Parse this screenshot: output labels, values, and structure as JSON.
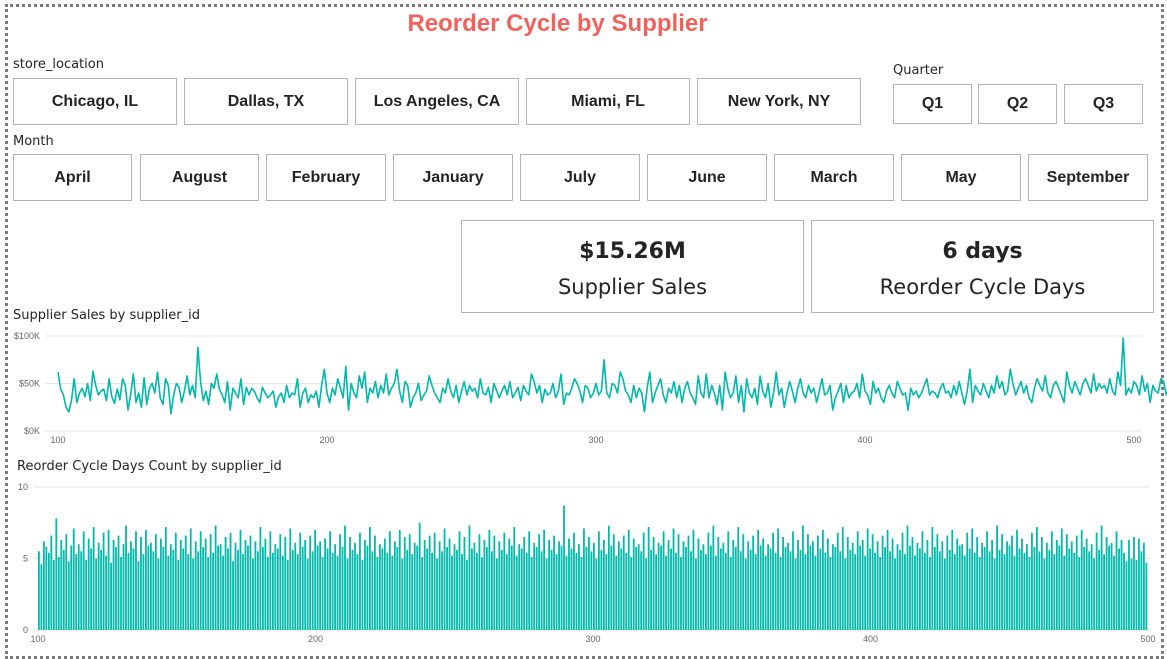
{
  "title": "Reorder Cycle by Supplier",
  "store_slicer": {
    "label": "store_location",
    "options": [
      "Chicago, IL",
      "Dallas, TX",
      "Los Angeles, CA",
      "Miami, FL",
      "New York, NY"
    ]
  },
  "quarter_slicer": {
    "label": "Quarter",
    "options": [
      "Q1",
      "Q2",
      "Q3"
    ]
  },
  "month_slicer": {
    "label": "Month",
    "options": [
      "April",
      "August",
      "February",
      "January",
      "July",
      "June",
      "March",
      "May",
      "September"
    ]
  },
  "cards": [
    {
      "value": "$15.26M",
      "label": "Supplier Sales"
    },
    {
      "value": "6 days",
      "label": "Reorder Cycle Days"
    }
  ],
  "colors": {
    "accent": "#01b8aa",
    "title": "#f0625b"
  },
  "chart_data": [
    {
      "type": "line",
      "title": "Supplier Sales by supplier_id",
      "xlim": [
        100,
        500
      ],
      "ylim": [
        0,
        100000
      ],
      "x_ticks": [
        "100",
        "200",
        "300",
        "400",
        "500"
      ],
      "y_ticks": [
        "$0K",
        "$50K",
        "$100K"
      ],
      "x_start": 100,
      "grid": true,
      "values": [
        62000,
        44000,
        38000,
        25000,
        20000,
        32000,
        55000,
        30000,
        40000,
        45000,
        36000,
        50000,
        32000,
        63000,
        48000,
        38000,
        42000,
        44000,
        32000,
        55000,
        36000,
        29000,
        44000,
        33000,
        55000,
        48000,
        22000,
        38000,
        60000,
        30000,
        40000,
        25000,
        56000,
        28000,
        45000,
        50000,
        40000,
        62000,
        35000,
        28000,
        55000,
        48000,
        18000,
        38000,
        50000,
        46000,
        30000,
        42000,
        58000,
        38000,
        48000,
        35000,
        88000,
        52000,
        32000,
        42000,
        28000,
        50000,
        45000,
        60000,
        44000,
        38000,
        30000,
        52000,
        22000,
        45000,
        40000,
        35000,
        55000,
        28000,
        46000,
        38000,
        45000,
        42000,
        35000,
        30000,
        46000,
        40000,
        35000,
        38000,
        42000,
        25000,
        36000,
        40000,
        30000,
        48000,
        35000,
        40000,
        38000,
        55000,
        25000,
        40000,
        45000,
        30000,
        38000,
        35000,
        42000,
        25000,
        48000,
        65000,
        40000,
        30000,
        45000,
        38000,
        55000,
        45000,
        35000,
        68000,
        22000,
        50000,
        40000,
        35000,
        58000,
        45000,
        62000,
        30000,
        45000,
        40000,
        52000,
        35000,
        48000,
        40000,
        60000,
        38000,
        45000,
        50000,
        65000,
        42000,
        30000,
        52000,
        48000,
        25000,
        35000,
        40000,
        50000,
        32000,
        38000,
        42000,
        58000,
        48000,
        40000,
        35000,
        30000,
        45000,
        40000,
        55000,
        42000,
        35000,
        48000,
        30000,
        42000,
        52000,
        38000,
        48000,
        42000,
        45000,
        35000,
        55000,
        40000,
        38000,
        46000,
        30000,
        50000,
        43000,
        35000,
        42000,
        48000,
        38000,
        52000,
        35000,
        40000,
        46000,
        32000,
        48000,
        42000,
        38000,
        60000,
        52000,
        40000,
        48000,
        30000,
        44000,
        38000,
        40000,
        50000,
        35000,
        42000,
        60000,
        28000,
        40000,
        38000,
        45000,
        55000,
        50000,
        42000,
        30000,
        48000,
        45000,
        35000,
        40000,
        50000,
        38000,
        42000,
        75000,
        40000,
        35000,
        50000,
        48000,
        40000,
        62000,
        55000,
        42000,
        38000,
        30000,
        48000,
        35000,
        45000,
        40000,
        20000,
        45000,
        62000,
        30000,
        40000,
        48000,
        55000,
        38000,
        30000,
        45000,
        40000,
        52000,
        35000,
        48000,
        30000,
        45000,
        52000,
        40000,
        35000,
        28000,
        58000,
        40000,
        35000,
        60000,
        35000,
        48000,
        40000,
        28000,
        48000,
        22000,
        62000,
        45000,
        35000,
        40000,
        58000,
        30000,
        48000,
        20000,
        55000,
        40000,
        35000,
        45000,
        28000,
        58000,
        42000,
        35000,
        50000,
        25000,
        40000,
        62000,
        38000,
        45000,
        25000,
        40000,
        52000,
        42000,
        30000,
        45000,
        55000,
        40000,
        35000,
        48000,
        40000,
        45000,
        30000,
        42000,
        55000,
        38000,
        40000,
        48000,
        22000,
        35000,
        42000,
        50000,
        30000,
        48000,
        35000,
        40000,
        42000,
        50000,
        35000,
        60000,
        42000,
        38000,
        28000,
        52000,
        40000,
        45000,
        35000,
        30000,
        42000,
        48000,
        40000,
        35000,
        52000,
        45000,
        38000,
        40000,
        22000,
        45000,
        38000,
        42000,
        35000,
        40000,
        48000,
        55000,
        38000,
        42000,
        40000,
        35000,
        45000,
        50000,
        40000,
        42000,
        35000,
        48000,
        38000,
        52000,
        40000,
        28000,
        42000,
        65000,
        30000,
        48000,
        42000,
        38000,
        50000,
        42000,
        35000,
        48000,
        40000,
        58000,
        45000,
        52000,
        38000,
        42000,
        65000,
        50000,
        38000,
        45000,
        52000,
        40000,
        48000,
        35000,
        30000,
        45000,
        55000,
        48000,
        42000,
        58000,
        40000,
        35000,
        48000,
        52000,
        45000,
        38000,
        30000,
        62000,
        48000,
        40000,
        52000,
        45000,
        38000,
        50000,
        55000,
        48000,
        40000,
        60000,
        42000,
        50000,
        45000,
        48000,
        40000,
        55000,
        42000,
        38000,
        62000,
        48000,
        98000,
        38000,
        45000,
        40000,
        52000,
        48000,
        38000,
        58000,
        42000,
        50000,
        30000,
        48000,
        42000,
        40000,
        55000,
        52000,
        38000,
        45000,
        40000,
        48000,
        68000,
        42000,
        55000,
        45000,
        40000,
        72000,
        38000,
        55000,
        48000,
        45000,
        38000,
        60000,
        42000,
        35000,
        50000,
        45000,
        42000,
        55000,
        40000,
        48000,
        52000,
        30000,
        55000,
        50000,
        50000
      ]
    },
    {
      "type": "bar",
      "title": "Reorder Cycle Days Count by supplier_id",
      "xlim": [
        100,
        500
      ],
      "ylim": [
        0,
        10
      ],
      "x_ticks": [
        "100",
        "200",
        "300",
        "400",
        "500"
      ],
      "y_ticks": [
        "0",
        "5",
        "10"
      ],
      "x_start": 100,
      "grid": true,
      "values": [
        5.5,
        4.6,
        6.2,
        5.8,
        5.4,
        6.6,
        4.9,
        7.8,
        5.1,
        6.3,
        5.6,
        6.7,
        4.8,
        5.9,
        7.1,
        5.3,
        6.0,
        5.5,
        6.9,
        4.9,
        6.4,
        5.7,
        7.2,
        5.0,
        6.1,
        5.6,
        6.8,
        5.2,
        7.0,
        4.7,
        6.3,
        5.8,
        6.6,
        5.1,
        6.0,
        7.3,
        5.4,
        6.2,
        5.7,
        6.9,
        4.8,
        6.5,
        5.3,
        7.0,
        5.9,
        6.1,
        5.5,
        6.7,
        5.0,
        6.4,
        5.8,
        7.2,
        5.2,
        6.0,
        5.6,
        6.8,
        4.9,
        6.3,
        5.7,
        6.6,
        5.3,
        7.1,
        5.0,
        6.2,
        5.5,
        6.9,
        5.8,
        6.4,
        5.1,
        6.7,
        5.4,
        7.3,
        5.9,
        6.0,
        5.2,
        6.5,
        5.7,
        6.8,
        4.8,
        6.1,
        5.6,
        7.0,
        5.3,
        6.3,
        5.9,
        6.6,
        5.0,
        6.2,
        5.5,
        7.2,
        5.8,
        6.4,
        5.1,
        6.9,
        5.4,
        6.0,
        5.7,
        6.7,
        5.2,
        6.5,
        4.9,
        7.1,
        5.6,
        6.1,
        5.3,
        6.8,
        5.8,
        6.3,
        5.0,
        6.6,
        5.5,
        7.0,
        5.9,
        6.2,
        5.1,
        6.4,
        5.7,
        6.9,
        5.4,
        6.0,
        5.2,
        6.7,
        5.8,
        7.3,
        5.0,
        6.5,
        5.6,
        6.1,
        5.3,
        6.8,
        4.9,
        6.3,
        5.9,
        7.2,
        5.5,
        6.6,
        5.1,
        6.0,
        5.7,
        6.4,
        5.4,
        6.9,
        5.2,
        6.2,
        5.8,
        7.0,
        5.0,
        6.5,
        5.6,
        6.7,
        5.3,
        6.1,
        5.9,
        7.5,
        5.1,
        6.3,
        5.7,
        6.6,
        5.4,
        6.8,
        5.0,
        6.2,
        5.5,
        7.1,
        5.8,
        6.4,
        5.2,
        6.0,
        5.6,
        6.9,
        5.3,
        6.5,
        4.9,
        7.3,
        5.7,
        6.1,
        5.4,
        6.7,
        5.1,
        6.3,
        5.8,
        7.0,
        5.5,
        6.6,
        5.0,
        6.2,
        5.6,
        6.8,
        5.3,
        6.4,
        5.9,
        7.2,
        5.2,
        6.0,
        5.7,
        6.5,
        5.4,
        6.9,
        5.1,
        6.1,
        5.8,
        6.7,
        5.5,
        7.0,
        5.0,
        6.3,
        5.6,
        6.6,
        5.3,
        6.2,
        5.9,
        8.7,
        5.2,
        6.4,
        5.7,
        6.8,
        5.4,
        6.0,
        5.1,
        7.1,
        5.8,
        6.5,
        5.5,
        6.1,
        5.0,
        6.9,
        5.6,
        6.3,
        5.3,
        7.3,
        5.9,
        6.7,
        5.2,
        6.2,
        5.7,
        6.6,
        5.4,
        7.0,
        5.1,
        6.4,
        5.8,
        6.0,
        5.5,
        6.8,
        5.0,
        7.2,
        5.6,
        6.5,
        5.3,
        6.1,
        5.9,
        6.9,
        5.2,
        6.3,
        5.7,
        7.1,
        5.4,
        6.7,
        5.1,
        6.2,
        5.8,
        6.6,
        5.5,
        7.0,
        5.0,
        6.4,
        5.6,
        6.0,
        5.3,
        6.8,
        5.9,
        7.3,
        5.2,
        6.5,
        5.7,
        6.1,
        5.4,
        6.9,
        5.1,
        6.3,
        5.8,
        7.2,
        5.5,
        6.7,
        5.0,
        6.2,
        5.6,
        6.6,
        5.3,
        7.0,
        5.9,
        6.4,
        5.2,
        6.0,
        5.7,
        6.8,
        5.4,
        7.1,
        5.1,
        6.5,
        5.8,
        6.1,
        5.5,
        6.9,
        5.0,
        6.3,
        5.6,
        7.3,
        5.3,
        6.7,
        5.9,
        6.2,
        5.2,
        6.6,
        5.7,
        7.0,
        5.4,
        6.4,
        5.1,
        6.0,
        5.8,
        6.8,
        5.5,
        7.2,
        5.0,
        6.5,
        5.6,
        6.1,
        5.3,
        6.9,
        5.9,
        6.3,
        5.2,
        7.1,
        5.7,
        6.7,
        5.4,
        6.2,
        5.1,
        6.6,
        5.8,
        7.0,
        5.5,
        6.4,
        5.0,
        6.0,
        5.6,
        6.8,
        5.3,
        7.3,
        5.9,
        6.5,
        5.2,
        6.1,
        5.7,
        6.9,
        5.4,
        6.3,
        5.1,
        7.2,
        5.8,
        6.7,
        5.5,
        6.2,
        5.0,
        6.6,
        5.6,
        7.0,
        5.3,
        6.4,
        5.9,
        6.0,
        5.2,
        6.8,
        5.7,
        7.1,
        5.4,
        6.5,
        5.1,
        6.1,
        5.8,
        6.9,
        5.5,
        6.3,
        5.0,
        7.3,
        5.6,
        6.7,
        5.3,
        6.2,
        5.9,
        6.6,
        5.2,
        7.0,
        5.7,
        6.4,
        5.4,
        6.0,
        5.1,
        6.8,
        5.8,
        7.2,
        5.5,
        6.5,
        5.0,
        6.1,
        5.6,
        6.9,
        5.3,
        6.3,
        5.9,
        7.1,
        5.2,
        6.7,
        5.7,
        6.2,
        5.4,
        6.6,
        5.1,
        7.0,
        5.8,
        6.4,
        5.5,
        6.0,
        5.0,
        6.8,
        5.6,
        7.3,
        5.3,
        6.5,
        5.9,
        6.1,
        5.2,
        6.9,
        5.7,
        6.3,
        5.4,
        4.8,
        6.3,
        5.0,
        6.5,
        4.9,
        6.4,
        5.5,
        6.1,
        4.7
      ]
    }
  ]
}
